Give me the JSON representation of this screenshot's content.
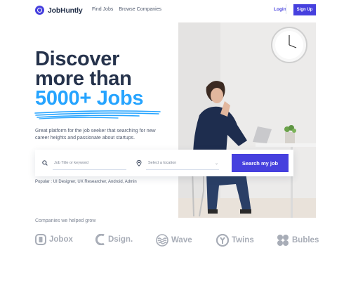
{
  "brand": {
    "name": "JobHuntly"
  },
  "nav": {
    "links": [
      "Find Jobs",
      "Browse Companies"
    ],
    "login": "Login",
    "signup": "Sign Up"
  },
  "hero": {
    "line1": "Discover",
    "line2": "more than",
    "highlight": "5000+ Jobs",
    "subtitle": "Great platform for the job seeker that searching for new career heights and passionate about startups."
  },
  "search": {
    "keyword_placeholder": "Job Title or keyword",
    "location_value": "Select a location",
    "button": "Search my job"
  },
  "popular": {
    "label": "Popular :",
    "items": "UI Designer, UX Researcher, Android, Admin"
  },
  "companies": {
    "label": "Companies we helped grow",
    "logos": [
      "Jobox",
      "Dsign.",
      "Wave",
      "Twins",
      "Bubles"
    ]
  },
  "colors": {
    "primary": "#4640DE",
    "accent": "#26A4FF",
    "text": "#25324B",
    "muted": "#A8ADB7"
  }
}
